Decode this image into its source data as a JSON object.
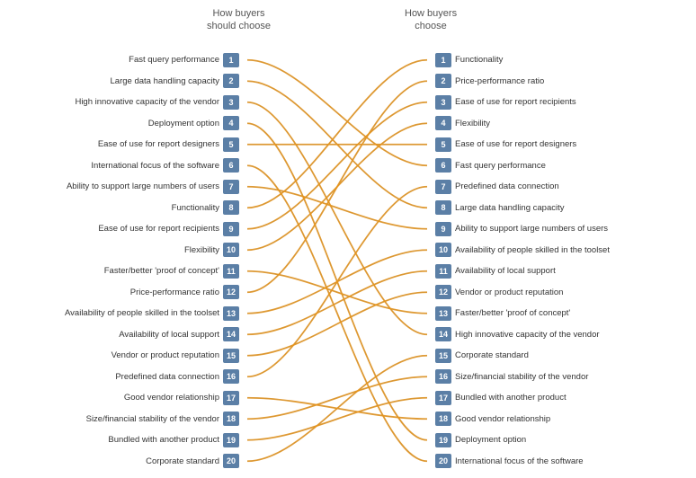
{
  "headers": {
    "left": "How buyers\nshould choose",
    "right": "How buyers\nchoose"
  },
  "leftItems": [
    {
      "rank": 1,
      "label": "Fast query performance"
    },
    {
      "rank": 2,
      "label": "Large data handling capacity"
    },
    {
      "rank": 3,
      "label": "High innovative capacity of the vendor"
    },
    {
      "rank": 4,
      "label": "Deployment option"
    },
    {
      "rank": 5,
      "label": "Ease of use for report designers"
    },
    {
      "rank": 6,
      "label": "International focus of the software"
    },
    {
      "rank": 7,
      "label": "Ability to support large numbers of users"
    },
    {
      "rank": 8,
      "label": "Functionality"
    },
    {
      "rank": 9,
      "label": "Ease of use for report recipients"
    },
    {
      "rank": 10,
      "label": "Flexibility"
    },
    {
      "rank": 11,
      "label": "Faster/better 'proof of concept'"
    },
    {
      "rank": 12,
      "label": "Price-performance ratio"
    },
    {
      "rank": 13,
      "label": "Availability of people skilled in the toolset"
    },
    {
      "rank": 14,
      "label": "Availability of local support"
    },
    {
      "rank": 15,
      "label": "Vendor or product reputation"
    },
    {
      "rank": 16,
      "label": "Predefined data connection"
    },
    {
      "rank": 17,
      "label": "Good vendor relationship"
    },
    {
      "rank": 18,
      "label": "Size/financial stability of the vendor"
    },
    {
      "rank": 19,
      "label": "Bundled with another product"
    },
    {
      "rank": 20,
      "label": "Corporate standard"
    }
  ],
  "rightItems": [
    {
      "rank": 1,
      "label": "Functionality"
    },
    {
      "rank": 2,
      "label": "Price-performance ratio"
    },
    {
      "rank": 3,
      "label": "Ease of use for report recipients"
    },
    {
      "rank": 4,
      "label": "Flexibility"
    },
    {
      "rank": 5,
      "label": "Ease of use for report designers"
    },
    {
      "rank": 6,
      "label": "Fast query performance"
    },
    {
      "rank": 7,
      "label": "Predefined data connection"
    },
    {
      "rank": 8,
      "label": "Large data handling capacity"
    },
    {
      "rank": 9,
      "label": "Ability to support large numbers of users"
    },
    {
      "rank": 10,
      "label": "Availability of people skilled in the toolset"
    },
    {
      "rank": 11,
      "label": "Availability of local support"
    },
    {
      "rank": 12,
      "label": "Vendor or product reputation"
    },
    {
      "rank": 13,
      "label": "Faster/better 'proof of concept'"
    },
    {
      "rank": 14,
      "label": "High innovative capacity of the vendor"
    },
    {
      "rank": 15,
      "label": "Corporate standard"
    },
    {
      "rank": 16,
      "label": "Size/financial stability of the vendor"
    },
    {
      "rank": 17,
      "label": "Bundled with another product"
    },
    {
      "rank": 18,
      "label": "Good vendor relationship"
    },
    {
      "rank": 19,
      "label": "Deployment option"
    },
    {
      "rank": 20,
      "label": "International focus of the software"
    }
  ],
  "connections": [
    {
      "from": 1,
      "to": 6,
      "type": "orange"
    },
    {
      "from": 2,
      "to": 8,
      "type": "orange"
    },
    {
      "from": 3,
      "to": 14,
      "type": "orange"
    },
    {
      "from": 4,
      "to": 19,
      "type": "orange"
    },
    {
      "from": 5,
      "to": 5,
      "type": "orange"
    },
    {
      "from": 6,
      "to": 20,
      "type": "orange"
    },
    {
      "from": 7,
      "to": 9,
      "type": "orange"
    },
    {
      "from": 8,
      "to": 1,
      "type": "orange"
    },
    {
      "from": 9,
      "to": 3,
      "type": "orange"
    },
    {
      "from": 10,
      "to": 4,
      "type": "orange"
    },
    {
      "from": 11,
      "to": 13,
      "type": "orange"
    },
    {
      "from": 12,
      "to": 2,
      "type": "orange"
    },
    {
      "from": 13,
      "to": 10,
      "type": "orange"
    },
    {
      "from": 14,
      "to": 11,
      "type": "orange"
    },
    {
      "from": 15,
      "to": 12,
      "type": "orange"
    },
    {
      "from": 16,
      "to": 7,
      "type": "orange"
    },
    {
      "from": 17,
      "to": 18,
      "type": "orange"
    },
    {
      "from": 18,
      "to": 16,
      "type": "orange"
    },
    {
      "from": 19,
      "to": 17,
      "type": "orange"
    },
    {
      "from": 20,
      "to": 15,
      "type": "orange"
    }
  ]
}
